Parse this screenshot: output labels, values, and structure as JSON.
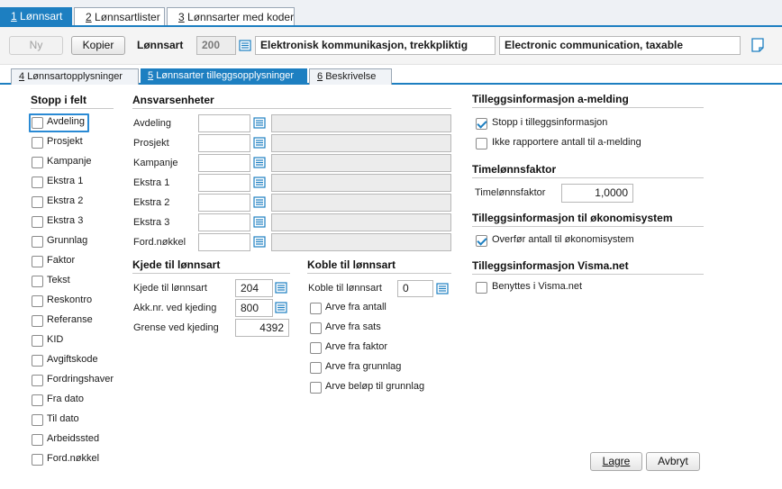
{
  "top_tabs": [
    {
      "num": "1",
      "label": "Lønnsart"
    },
    {
      "num": "2",
      "label": "Lønnsartlister"
    },
    {
      "num": "3",
      "label": "Lønnsarter med koder"
    }
  ],
  "header": {
    "new_label": "Ny",
    "copy_label": "Kopier",
    "field_label": "Lønnsart",
    "number": "200",
    "name_no": "Elektronisk kommunikasjon, trekkpliktig",
    "name_en": "Electronic communication, taxable"
  },
  "sub_tabs": [
    {
      "num": "4",
      "label": "Lønnsartopplysninger"
    },
    {
      "num": "5",
      "label": "Lønnsarter tilleggsopplysninger"
    },
    {
      "num": "6",
      "label": "Beskrivelse"
    }
  ],
  "stop": {
    "title": "Stopp i felt",
    "items": [
      "Avdeling",
      "Prosjekt",
      "Kampanje",
      "Ekstra 1",
      "Ekstra 2",
      "Ekstra 3",
      "Grunnlag",
      "Faktor",
      "Tekst",
      "Reskontro",
      "Referanse",
      "KID",
      "Avgiftskode",
      "Fordringshaver",
      "Fra dato",
      "Til dato",
      "Arbeidssted",
      "Ford.nøkkel"
    ]
  },
  "ansvar": {
    "title": "Ansvarsenheter",
    "rows": [
      "Avdeling",
      "Prosjekt",
      "Kampanje",
      "Ekstra 1",
      "Ekstra 2",
      "Ekstra 3",
      "Ford.nøkkel"
    ]
  },
  "kjede": {
    "title": "Kjede til lønnsart",
    "rows": [
      {
        "label": "Kjede til lønnsart",
        "value": "204"
      },
      {
        "label": "Akk.nr. ved kjeding",
        "value": "800"
      },
      {
        "label": "Grense ved kjeding",
        "value": "4392"
      }
    ]
  },
  "koble": {
    "title": "Koble til lønnsart",
    "field_label": "Koble til lønnsart",
    "value": "0",
    "checks": [
      "Arve fra antall",
      "Arve fra sats",
      "Arve fra faktor",
      "Arve fra grunnlag",
      "Arve beløp til grunnlag"
    ]
  },
  "amelding": {
    "title": "Tilleggsinformasjon a-melding",
    "checks": [
      {
        "label": "Stopp i tilleggsinformasjon",
        "checked": true
      },
      {
        "label": "Ikke rapportere antall til a-melding",
        "checked": false
      }
    ]
  },
  "timelonn": {
    "title": "Timelønnsfaktor",
    "label": "Timelønnsfaktor",
    "value": "1,0000"
  },
  "okonomi": {
    "title": "Tilleggsinformasjon til økonomisystem",
    "checks": [
      {
        "label": "Overfør antall til økonomisystem",
        "checked": true
      }
    ]
  },
  "visma": {
    "title": "Tilleggsinformasjon Visma.net",
    "checks": [
      {
        "label": "Benyttes i Visma.net",
        "checked": false
      }
    ]
  },
  "footer": {
    "save_label": "Lagre",
    "cancel_label": "Avbryt"
  },
  "colors": {
    "accent": "#1d7fc1"
  }
}
